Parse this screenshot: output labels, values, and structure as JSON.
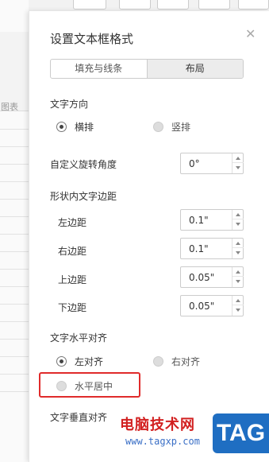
{
  "panel": {
    "title": "设置文本框格式",
    "tabs": [
      {
        "label": "填充与线条",
        "active": false
      },
      {
        "label": "布局",
        "active": true
      }
    ]
  },
  "text_direction": {
    "heading": "文字方向",
    "options": [
      {
        "label": "横排",
        "selected": true
      },
      {
        "label": "竖排",
        "selected": false
      }
    ]
  },
  "rotation": {
    "label": "自定义旋转角度",
    "value": "0°"
  },
  "margins": {
    "heading": "形状内文字边距",
    "left": {
      "label": "左边距",
      "value": "0.1\""
    },
    "right": {
      "label": "右边距",
      "value": "0.1\""
    },
    "top": {
      "label": "上边距",
      "value": "0.05\""
    },
    "bottom": {
      "label": "下边距",
      "value": "0.05\""
    }
  },
  "h_align": {
    "heading": "文字水平对齐",
    "options": [
      {
        "label": "左对齐",
        "selected": true
      },
      {
        "label": "右对齐",
        "selected": false
      },
      {
        "label": "水平居中",
        "selected": false
      }
    ]
  },
  "v_align": {
    "heading": "文字垂直对齐"
  },
  "background": {
    "toolbar_text": "图表"
  },
  "watermark": {
    "text": "电脑技术网",
    "url": "www.tagxp.com",
    "badge": "TAG"
  }
}
